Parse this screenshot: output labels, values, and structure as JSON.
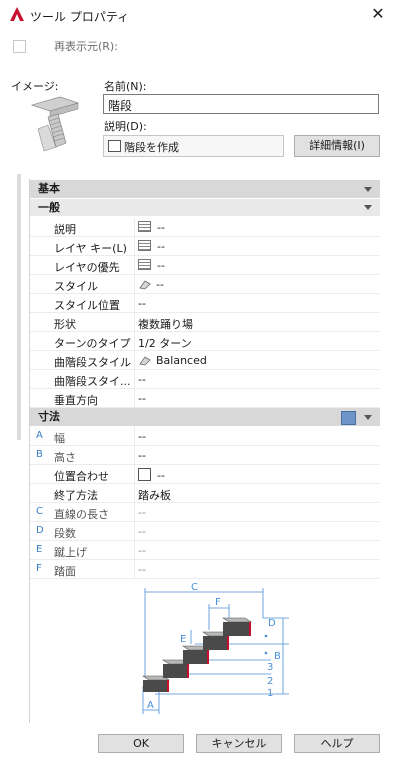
{
  "window": {
    "title": "ツール プロパティ",
    "close_glyph": "✕"
  },
  "refresh": {
    "label": "再表示元(R):",
    "checked": false
  },
  "image_label": "イメージ:",
  "name": {
    "label": "名前(N):",
    "value": "階段"
  },
  "description": {
    "label": "説明(D):",
    "value": "階段を作成"
  },
  "detail_button": "詳細情報(I)",
  "sections": {
    "basic": "基本",
    "general": "一般",
    "dimensions": "寸法"
  },
  "general_rows": [
    {
      "label": "説明",
      "value": "--",
      "icon": "grid-icon"
    },
    {
      "label": "レイヤ キー(L)",
      "value": "--",
      "icon": "grid-icon"
    },
    {
      "label": "レイヤの優先",
      "value": "--",
      "icon": "grid-icon"
    },
    {
      "label": "スタイル",
      "value": "--",
      "icon": "stair-style-icon"
    },
    {
      "label": "スタイル位置",
      "value": "--"
    },
    {
      "label": "形状",
      "value": "複数踊り場"
    },
    {
      "label": "ターンのタイプ",
      "value": "1/2 ターン"
    },
    {
      "label": "曲階段スタイル",
      "value": "Balanced",
      "icon": "curved-stair-icon"
    },
    {
      "label": "曲階段スタイ...",
      "value": "--"
    },
    {
      "label": "垂直方向",
      "value": "--"
    }
  ],
  "dimension_rows": [
    {
      "letter": "A",
      "label": "幅",
      "value": "--"
    },
    {
      "letter": "B",
      "label": "高さ",
      "value": "--"
    },
    {
      "letter": "",
      "label": "位置合わせ",
      "value": "--",
      "icon": "square-icon"
    },
    {
      "letter": "",
      "label": "終了方法",
      "value": "踏み板"
    },
    {
      "letter": "C",
      "label": "直線の長さ",
      "value": "--"
    },
    {
      "letter": "D",
      "label": "段数",
      "value": "--"
    },
    {
      "letter": "E",
      "label": "蹴上げ",
      "value": "--"
    },
    {
      "letter": "F",
      "label": "踏面",
      "value": "--"
    }
  ],
  "diagram_labels": {
    "c": "C",
    "f": "F",
    "e": "E",
    "d": "D",
    "b": "B",
    "a": "A",
    "n1": "1",
    "n2": "2",
    "n3": "3"
  },
  "buttons": {
    "ok": "OK",
    "cancel": "キャンセル",
    "help": "ヘルプ"
  },
  "colors": {
    "accent": "#3b7fc4",
    "section_bg": "#d8d8d8",
    "dim_line": "#4a8fd8",
    "app_icon": "#c8102e"
  }
}
